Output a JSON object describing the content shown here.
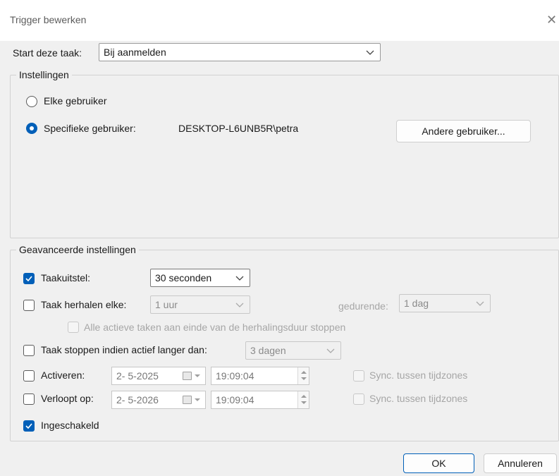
{
  "window": {
    "title": "Trigger bewerken",
    "close_glyph": "✕"
  },
  "start": {
    "label": "Start deze taak:",
    "value": "Bij aanmelden"
  },
  "settings": {
    "legend": "Instellingen",
    "radio_any": "Elke gebruiker",
    "radio_specific": "Specifieke gebruiker:",
    "selected": "specific",
    "user": "DESKTOP-L6UNB5R\\petra",
    "change_user_button": "Andere gebruiker..."
  },
  "advanced": {
    "legend": "Geavanceerde instellingen",
    "delay": {
      "label": "Taakuitstel:",
      "checked": true,
      "value": "30 seconden"
    },
    "repeat": {
      "label": "Taak herhalen elke:",
      "checked": false,
      "value": "1 uur",
      "duration_label": "gedurende:",
      "duration_value": "1 dag"
    },
    "stop_all": {
      "label": "Alle actieve taken aan einde van de herhalingsduur stoppen",
      "checked": false
    },
    "stop_longer": {
      "label": "Taak stoppen indien actief langer dan:",
      "checked": false,
      "value": "3 dagen"
    },
    "activate": {
      "label": "Activeren:",
      "checked": false,
      "date": "2- 5-2025",
      "time": "19:09:04",
      "sync_label": "Sync. tussen tijdzones"
    },
    "expire": {
      "label": "Verloopt op:",
      "checked": false,
      "date": "2- 5-2026",
      "time": "19:09:04",
      "sync_label": "Sync. tussen tijdzones"
    },
    "enabled": {
      "label": "Ingeschakeld",
      "checked": true
    }
  },
  "buttons": {
    "ok": "OK",
    "cancel": "Annuleren"
  },
  "colors": {
    "accent": "#005fb8",
    "dialog_bg": "#f0f0f0"
  },
  "icons": [
    "close-icon",
    "chevron-down-icon",
    "checkmark-icon",
    "calendar-icon",
    "spin-up-icon",
    "spin-down-icon"
  ]
}
